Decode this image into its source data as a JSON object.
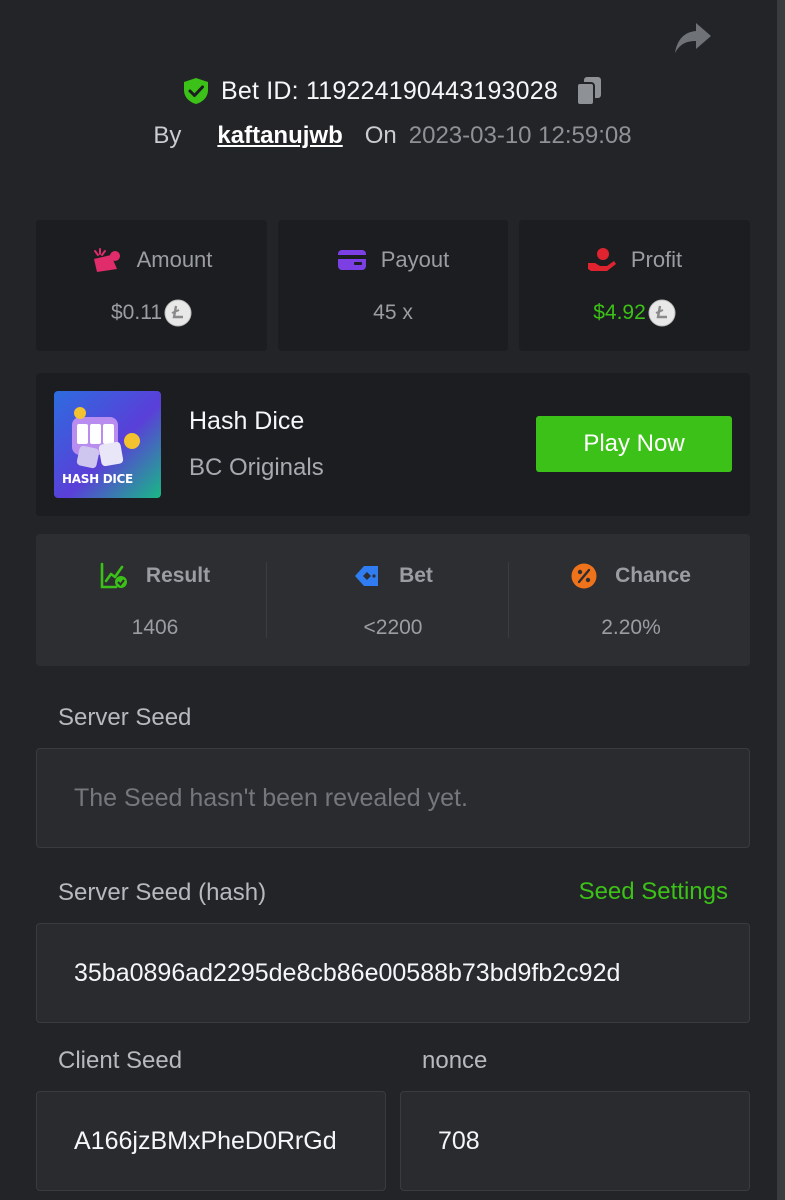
{
  "header": {
    "bet_id_label": "Bet ID: 119224190443193028",
    "by_label": "By",
    "username": "kaftanujwb",
    "on_label": "On",
    "datetime": "2023-03-10 12:59:08"
  },
  "stats": {
    "amount": {
      "label": "Amount",
      "value": "$0.11",
      "icon": "amount-icon",
      "color": "#e02c6a"
    },
    "payout": {
      "label": "Payout",
      "value": "45 x",
      "icon": "wallet-icon",
      "color": "#7b3fe4"
    },
    "profit": {
      "label": "Profit",
      "value": "$4.92",
      "icon": "hand-profit-icon",
      "color": "#e0242f",
      "value_color": "#3bc117"
    }
  },
  "game": {
    "name": "Hash Dice",
    "provider": "BC Originals",
    "thumb_text": "HASH DICE",
    "play_label": "Play Now"
  },
  "dice": {
    "result": {
      "label": "Result",
      "value": "1406"
    },
    "bet": {
      "label": "Bet",
      "value": "<2200"
    },
    "chance": {
      "label": "Chance",
      "value": "2.20%"
    }
  },
  "seeds": {
    "server_seed_label": "Server Seed",
    "server_seed_value": "The Seed hasn't been revealed yet.",
    "server_hash_label": "Server Seed (hash)",
    "seed_settings_label": "Seed Settings",
    "server_hash_value": "35ba0896ad2295de8cb86e00588b73bd9fb2c92d",
    "client_seed_label": "Client Seed",
    "client_seed_value": "A166jzBMxPheD0RrGd",
    "nonce_label": "nonce",
    "nonce_value": "708"
  },
  "colors": {
    "accent": "#3bc117",
    "background": "#232427",
    "card": "#1c1d20"
  }
}
